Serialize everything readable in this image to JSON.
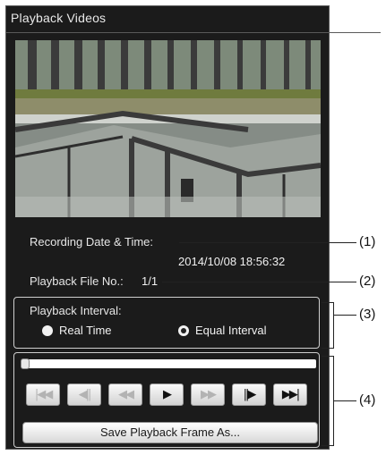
{
  "panel": {
    "title": "Playback Videos"
  },
  "recording": {
    "label": "Recording Date & Time:",
    "value": "2014/10/08 18:56:32"
  },
  "playback_file": {
    "label": "Playback File No.:",
    "value": "1/1"
  },
  "interval": {
    "legend": "Playback Interval:",
    "options": [
      {
        "label": "Real Time",
        "selected": false
      },
      {
        "label": "Equal Interval",
        "selected": true
      }
    ]
  },
  "seek": {
    "progress": 0.0
  },
  "controls": [
    {
      "name": "skip-to-start-button",
      "icon": "skip-to-start-icon",
      "glyph": "|◀◀",
      "enabled": false
    },
    {
      "name": "step-back-button",
      "icon": "step-back-icon",
      "glyph": "◀||",
      "enabled": false
    },
    {
      "name": "rewind-button",
      "icon": "rewind-icon",
      "glyph": "◀◀",
      "enabled": false
    },
    {
      "name": "play-button",
      "icon": "play-icon",
      "glyph": "▶",
      "enabled": true
    },
    {
      "name": "fast-forward-button",
      "icon": "fast-forward-icon",
      "glyph": "▶▶",
      "enabled": false
    },
    {
      "name": "step-forward-button",
      "icon": "step-forward-icon",
      "glyph": "||▶",
      "enabled": true
    },
    {
      "name": "skip-to-end-button",
      "icon": "skip-to-end-icon",
      "glyph": "▶▶|",
      "enabled": true
    }
  ],
  "save_button": {
    "label": "Save Playback Frame As..."
  },
  "callouts": [
    "(1)",
    "(2)",
    "(3)",
    "(4)"
  ]
}
